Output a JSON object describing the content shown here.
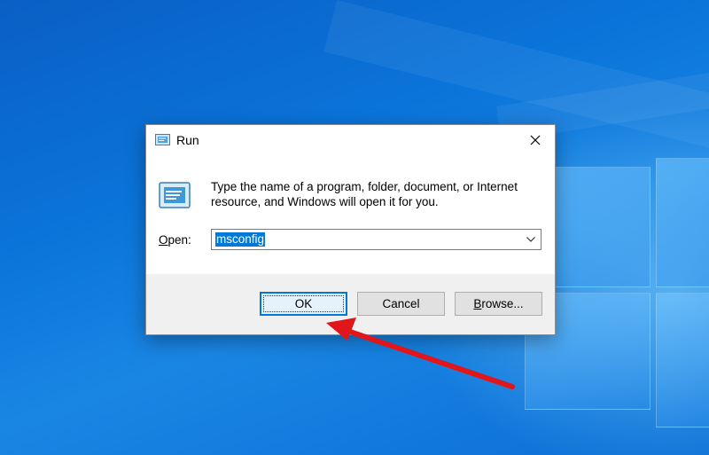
{
  "desktop": {
    "background_color": "#0a74da"
  },
  "dialog": {
    "title": "Run",
    "close_icon": "close-icon",
    "app_icon": "run-icon",
    "description": "Type the name of a program, folder, document, or Internet resource, and Windows will open it for you.",
    "open_label_accesskey": "O",
    "open_label_rest": "pen:",
    "combo": {
      "value": "msconfig",
      "dropdown_icon": "chevron-down-icon"
    },
    "buttons": {
      "ok_label": "OK",
      "cancel_label": "Cancel",
      "browse_accesskey": "B",
      "browse_rest": "rowse..."
    }
  },
  "annotation": {
    "arrow_color": "#e0161b",
    "points_to": "ok-button"
  },
  "colors": {
    "accent": "#0078d7",
    "dialog_footer": "#f0f0f0"
  }
}
